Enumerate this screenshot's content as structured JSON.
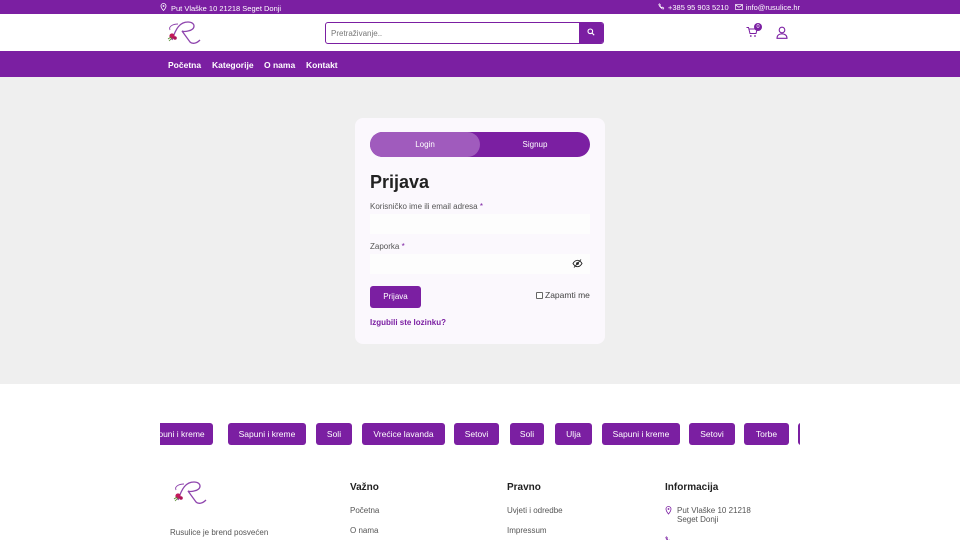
{
  "topbar": {
    "address": "Put Vlaške 10 21218 Seget Donji",
    "phone": "+385 95 903 5210",
    "email": "info@rusulice.hr"
  },
  "header": {
    "search_placeholder": "Pretraživanje..",
    "cart_count": "0"
  },
  "nav": {
    "items": [
      "Početna",
      "Kategorije",
      "O nama",
      "Kontakt"
    ]
  },
  "login": {
    "tab_login": "Login",
    "tab_signup": "Signup",
    "title": "Prijava",
    "username_label": "Korisničko ime ili email adresa",
    "password_label": "Zaporka",
    "required_mark": "*",
    "submit_label": "Prijava",
    "remember_label": "Zapamti me",
    "lost_password": "Izgubili ste lozinku?"
  },
  "categories": [
    "puni i kreme",
    "Sapuni i kreme",
    "Soli",
    "Vrećice lavanda",
    "Setovi",
    "Soli",
    "Ulja",
    "Sapuni i kreme",
    "Setovi",
    "Torbe"
  ],
  "footer": {
    "about_text": "Rusulice je brend posvećen",
    "columns": [
      {
        "title": "Važno",
        "links": [
          "Početna",
          "O nama"
        ]
      },
      {
        "title": "Pravno",
        "links": [
          "Uvjeti i odredbe",
          "Impressum"
        ]
      }
    ],
    "info_title": "Informacija",
    "info_address_line1": "Put Vlaške 10 21218",
    "info_address_line2": "Seget Donji"
  },
  "colors": {
    "brand": "#7b1fa2",
    "tab_active": "#a05bbd"
  }
}
